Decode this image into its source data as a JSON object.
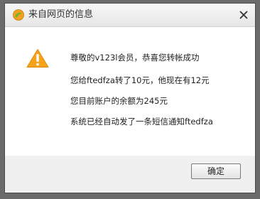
{
  "window": {
    "title": "来自网页的信息",
    "close_symbol": "✕"
  },
  "icons": {
    "title_icon": "browser-logo-icon",
    "warning_icon": "warning-triangle-icon",
    "close_icon": "close-icon",
    "warning_color": "#f7a21b",
    "logo_colors": [
      "#f4a21d",
      "#6ab82e"
    ]
  },
  "message": {
    "lines": [
      "尊敬的v123l会员，恭喜您转帐成功",
      "您给ftedfza转了10元，他现在有12元",
      "您目前账户的余额为245元",
      "系统已经自动发了一条短信通知ftedfza"
    ]
  },
  "footer": {
    "ok_label": "确定"
  }
}
